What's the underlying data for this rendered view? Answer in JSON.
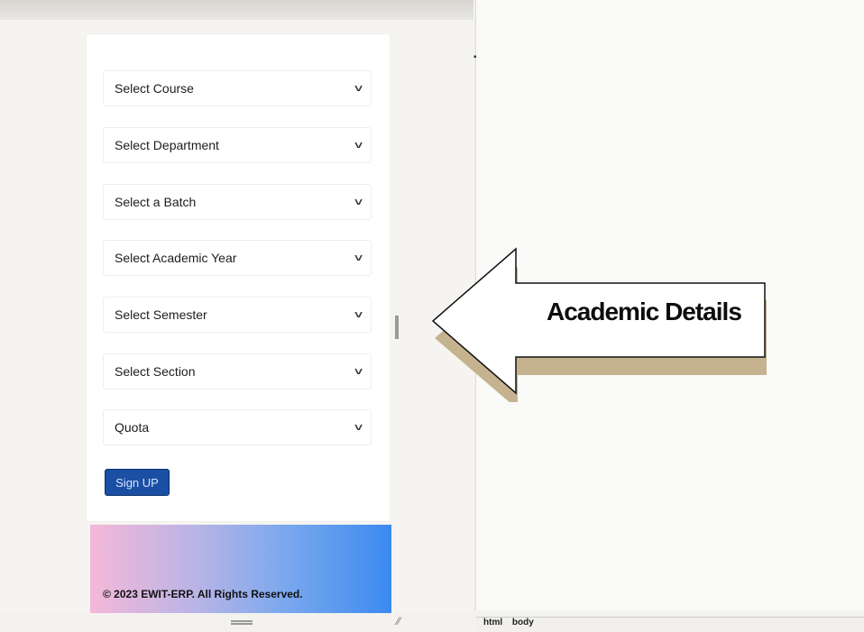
{
  "form": {
    "selects": [
      {
        "label": "Select Course"
      },
      {
        "label": "Select Department"
      },
      {
        "label": "Select a Batch"
      },
      {
        "label": "Select Academic Year"
      },
      {
        "label": "Select Semester"
      },
      {
        "label": "Select Section"
      },
      {
        "label": "Quota"
      }
    ],
    "signup_label": "Sign UP"
  },
  "footer": {
    "copyright": "© 2023 EWIT-ERP. All Rights Reserved."
  },
  "callout": {
    "text": "Academic Details"
  },
  "status_bar": {
    "crumbs": [
      "html",
      "body"
    ]
  },
  "colors": {
    "signup_bg": "#1a4fa3",
    "footer_gradient_start": "#f4b8d8",
    "footer_gradient_end": "#3b8af0"
  },
  "icons": {
    "select_chevron": "chevron-down-icon",
    "splitter": "splitter-handle-icon"
  }
}
